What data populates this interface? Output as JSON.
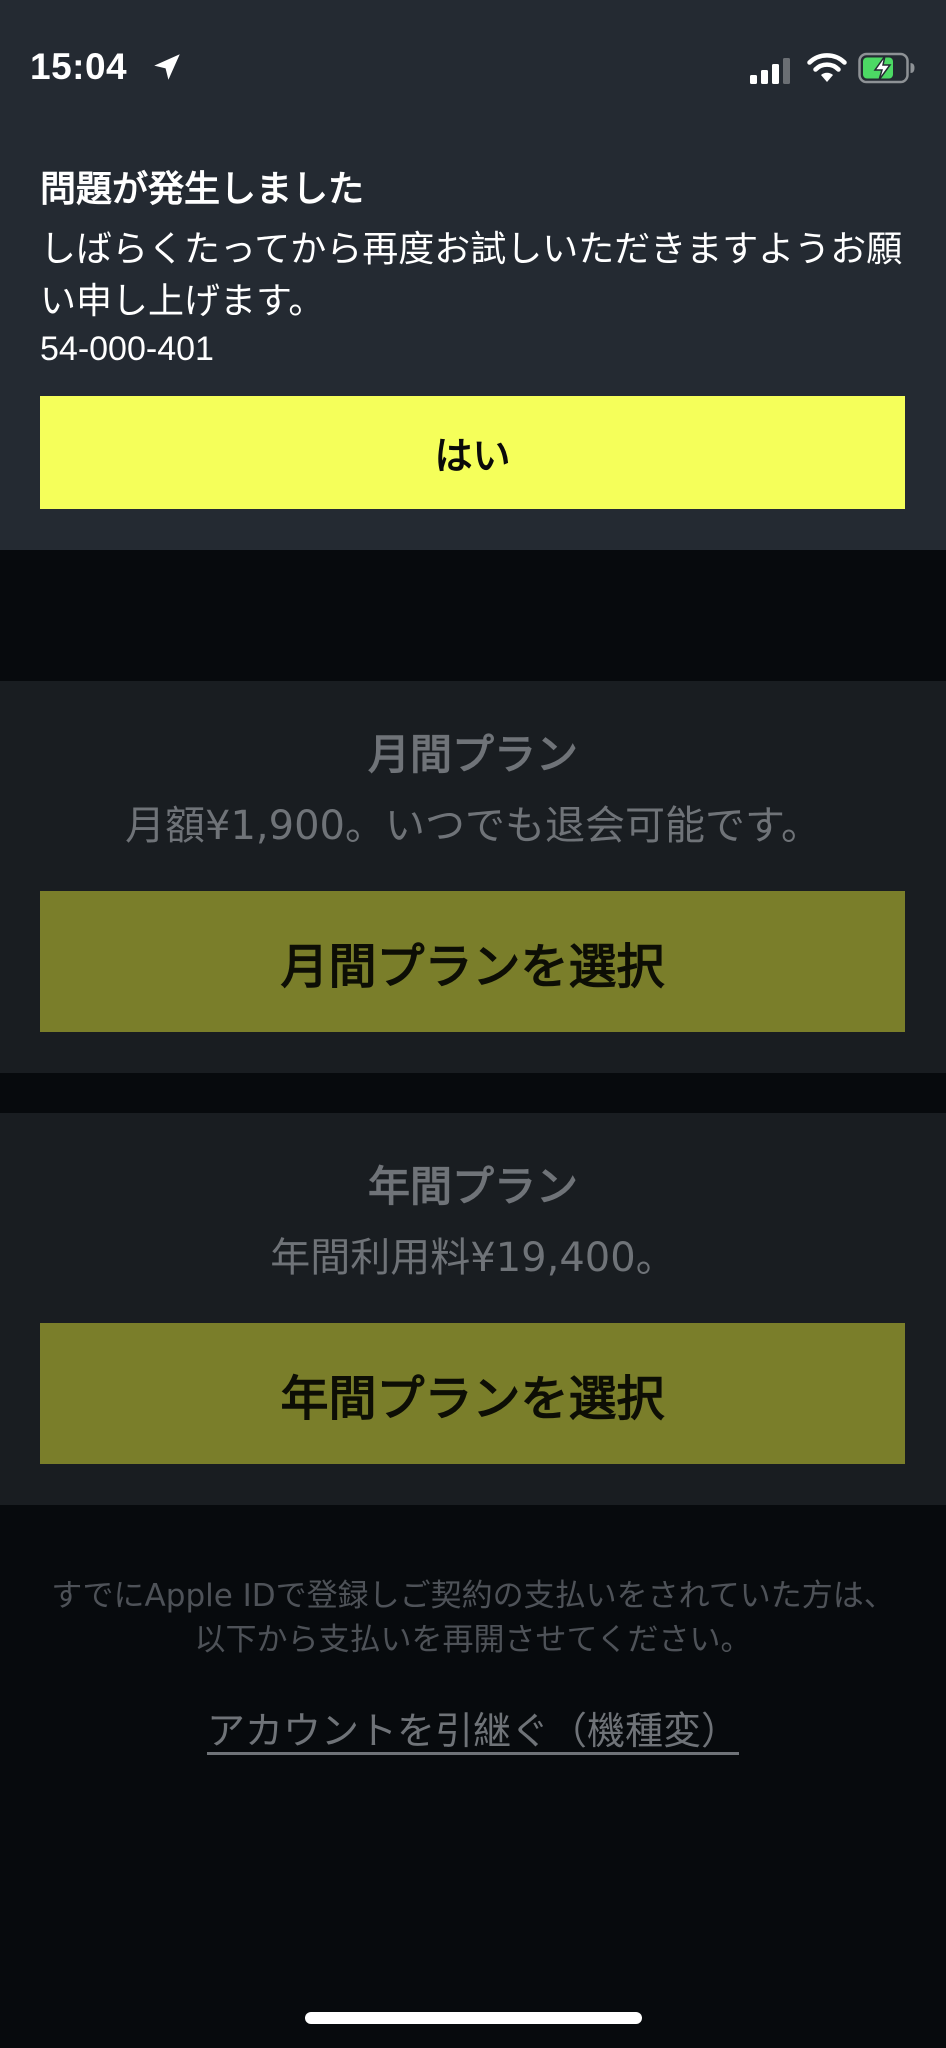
{
  "status_bar": {
    "time": "15:04",
    "icons": [
      "location-arrow-icon",
      "cellular-signal-icon",
      "wifi-icon",
      "battery-charging-icon"
    ],
    "battery_color": "#4cd964"
  },
  "error_banner": {
    "title": "問題が発生しました",
    "message": "しばらくたってから再度お試しいただきますようお願い申し上げます。",
    "code": "54-000-401",
    "ok_button": "はい",
    "button_color": "#f5ff5a"
  },
  "plans": {
    "monthly": {
      "title": "月間プラン",
      "price": "月額¥1,900。いつでも退会可能です。",
      "button": "月間プランを選択"
    },
    "yearly": {
      "title": "年間プラン",
      "price": "年間利用料¥19,400。",
      "button": "年間プランを選択"
    }
  },
  "footer": {
    "note": "すでにApple IDで登録しご契約の支払いをされていた方は、以下から支払いを再開させてください。",
    "transfer_link": "アカウントを引継ぐ（機種変）"
  }
}
